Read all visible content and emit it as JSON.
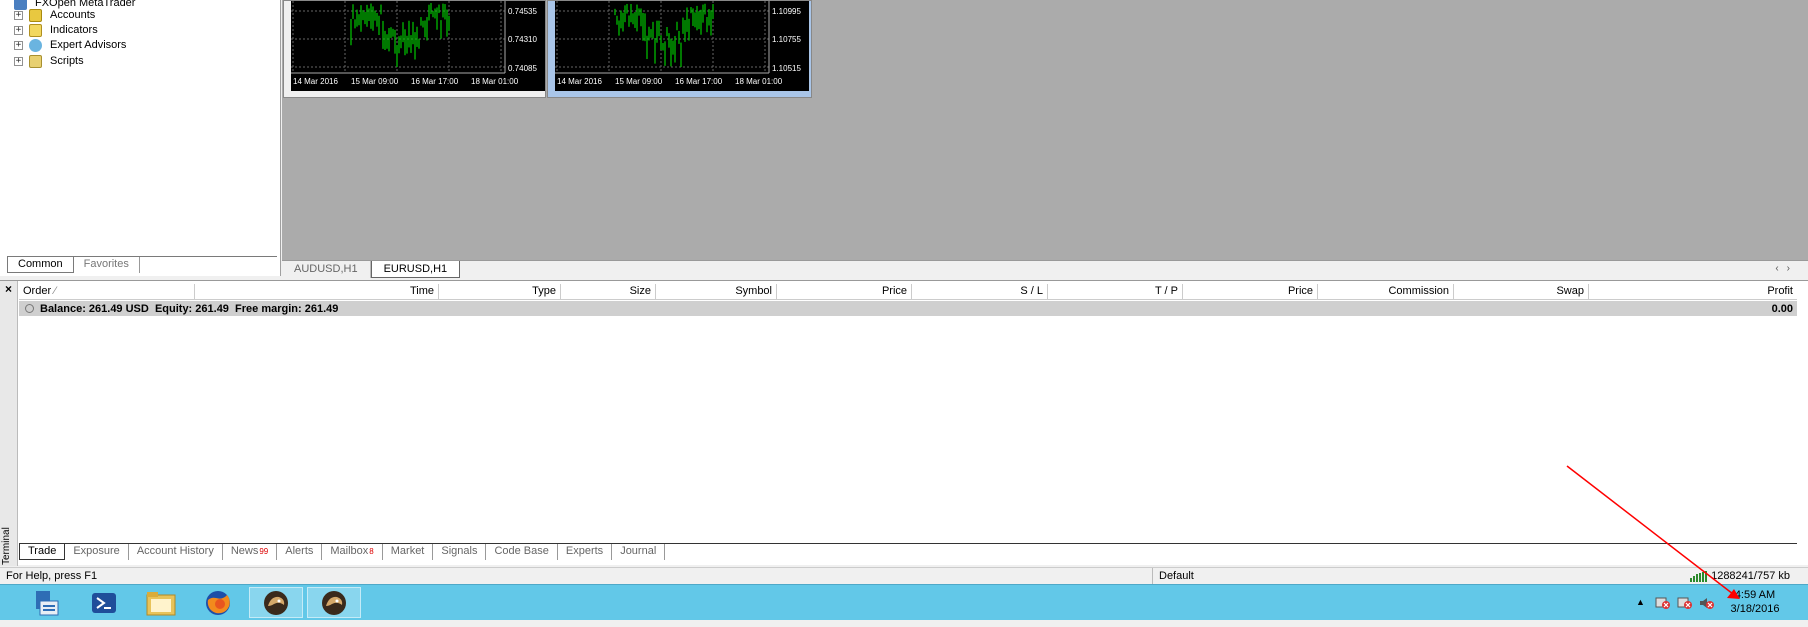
{
  "navigator": {
    "root_label": "FXOpen MetaTrader",
    "items": [
      {
        "label": "Accounts",
        "icon": "accounts-icon"
      },
      {
        "label": "Indicators",
        "icon": "indicators-icon"
      },
      {
        "label": "Expert Advisors",
        "icon": "expert-advisors-icon"
      },
      {
        "label": "Scripts",
        "icon": "scripts-icon"
      }
    ],
    "tabs": [
      "Common",
      "Favorites"
    ]
  },
  "charts": [
    {
      "symbol": "AUDUSD,H1",
      "price_ticks": [
        "0.74535",
        "0.74310",
        "0.74085"
      ],
      "time_ticks": [
        "14 Mar 2016",
        "15 Mar 09:00",
        "16 Mar 17:00",
        "18 Mar 01:00"
      ]
    },
    {
      "symbol": "EURUSD,H1",
      "price_ticks": [
        "1.10995",
        "1.10755",
        "1.10515"
      ],
      "time_ticks": [
        "14 Mar 2016",
        "15 Mar 09:00",
        "16 Mar 17:00",
        "18 Mar 01:00"
      ]
    }
  ],
  "chart_tabs": [
    "AUDUSD,H1",
    "EURUSD,H1"
  ],
  "terminal": {
    "side_label": "Terminal",
    "columns": [
      "Order",
      "Time",
      "Type",
      "Size",
      "Symbol",
      "Price",
      "S / L",
      "T / P",
      "Price",
      "Commission",
      "Swap",
      "Profit"
    ],
    "balance_text": "Balance: 261.49 USD  Equity: 261.49  Free margin: 261.49",
    "balance_profit": "0.00",
    "tabs": [
      {
        "label": "Trade",
        "count": ""
      },
      {
        "label": "Exposure",
        "count": ""
      },
      {
        "label": "Account History",
        "count": ""
      },
      {
        "label": "News",
        "count": "99"
      },
      {
        "label": "Alerts",
        "count": ""
      },
      {
        "label": "Mailbox",
        "count": "8"
      },
      {
        "label": "Market",
        "count": ""
      },
      {
        "label": "Signals",
        "count": ""
      },
      {
        "label": "Code Base",
        "count": ""
      },
      {
        "label": "Experts",
        "count": ""
      },
      {
        "label": "Journal",
        "count": ""
      }
    ]
  },
  "status_bar": {
    "help": "For Help, press F1",
    "profile": "Default",
    "traffic": "1288241/757 kb"
  },
  "taskbar": {
    "apps": [
      "server-manager-icon",
      "powershell-icon",
      "file-explorer-icon",
      "firefox-icon",
      "metatrader-icon",
      "metatrader-icon"
    ],
    "time": "4:59 AM",
    "date": "3/18/2016"
  },
  "colors": {
    "chart_bg": "#000000",
    "candle": "#00c800",
    "taskbar": "#62c8e8",
    "annotation_arrow": "#ff0000"
  }
}
